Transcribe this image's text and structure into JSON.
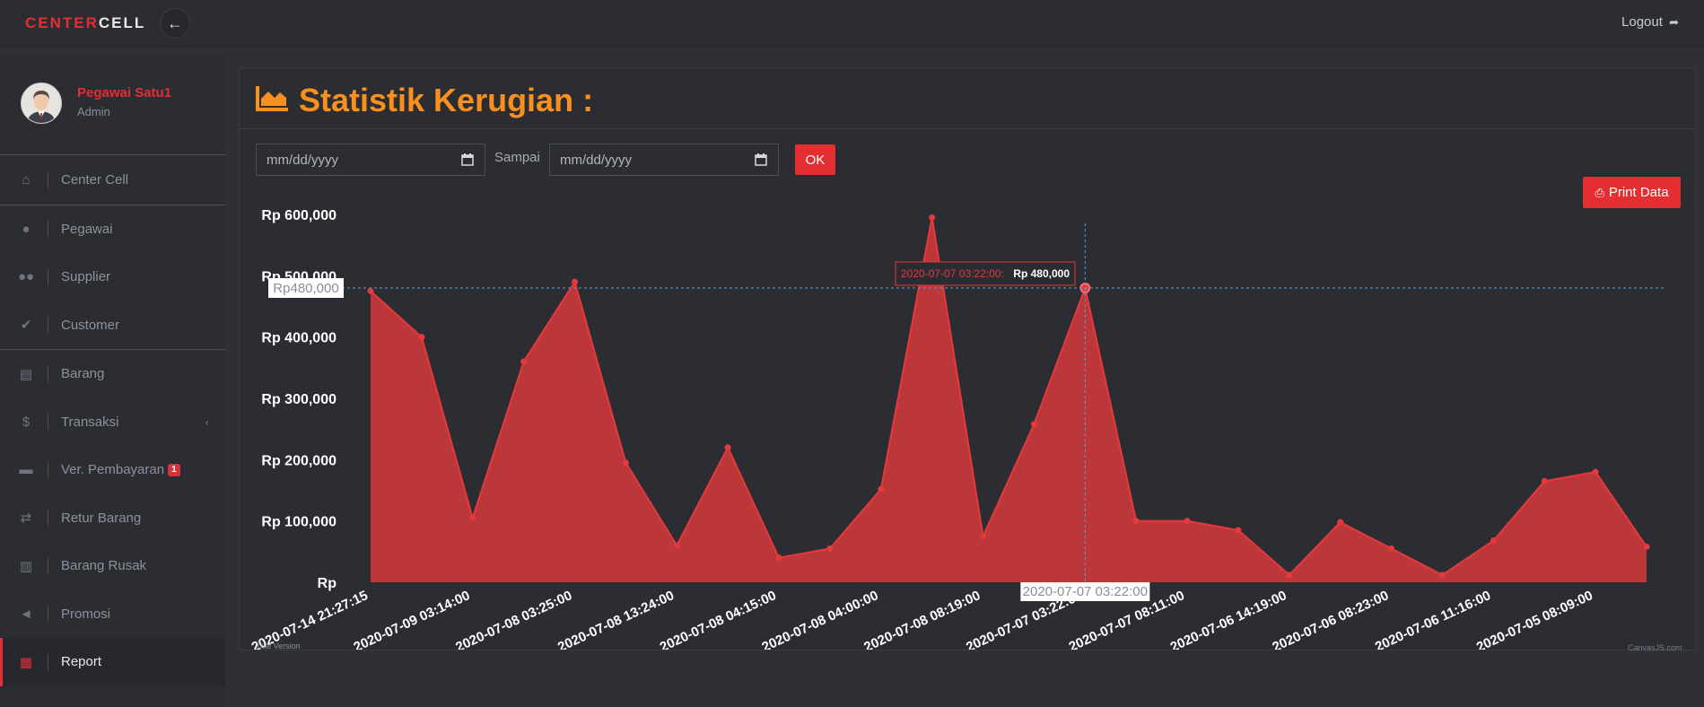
{
  "brand": {
    "part1": "CENTER",
    "part2": "CELL"
  },
  "topbar": {
    "back_icon": "arrow-left-icon",
    "logout_label": "Logout"
  },
  "profile": {
    "name": "Pegawai Satu1",
    "role": "Admin"
  },
  "sidebar": {
    "items": [
      {
        "label": "Center Cell",
        "icon": "store-icon"
      },
      {
        "label": "Pegawai",
        "icon": "user-icon"
      },
      {
        "label": "Supplier",
        "icon": "users-icon"
      },
      {
        "label": "Customer",
        "icon": "user-check-icon"
      },
      {
        "label": "Barang",
        "icon": "archive-icon"
      },
      {
        "label": "Transaksi",
        "icon": "money-icon"
      },
      {
        "label": "Ver. Pembayaran",
        "icon": "card-icon",
        "badge": "1"
      },
      {
        "label": "Retur Barang",
        "icon": "exchange-icon"
      },
      {
        "label": "Barang Rusak",
        "icon": "trash-icon"
      },
      {
        "label": "Promosi",
        "icon": "megaphone-icon"
      },
      {
        "label": "Report",
        "icon": "report-icon"
      }
    ]
  },
  "page": {
    "title": "Statistik Kerugian :",
    "date_from_placeholder": "mm/dd/yyyy",
    "sampai_label": "Sampai",
    "date_to_placeholder": "mm/dd/yyyy",
    "ok_label": "OK",
    "print_label": "Print Data"
  },
  "colors": {
    "accent": "#e52e32",
    "title": "#f7901e",
    "area_fill": "#c9383a"
  },
  "chart_data": {
    "type": "area",
    "x_tick_labels": [
      "2020-07-14 21:27:15",
      "2020-07-09 03:14:00",
      "2020-07-08 03:25:00",
      "2020-07-08 13:24:00",
      "2020-07-08 04:15:00",
      "2020-07-08 04:00:00",
      "2020-07-08 08:19:00",
      "2020-07-07 03:22:00",
      "2020-07-07 08:11:00",
      "2020-07-06 14:19:00",
      "2020-07-06 08:23:00",
      "2020-07-06 11:16:00",
      "2020-07-05 08:09:00"
    ],
    "values": [
      475000,
      400000,
      105000,
      360000,
      490000,
      195000,
      60000,
      220000,
      40000,
      55000,
      152000,
      595000,
      75000,
      258000,
      480000,
      100000,
      100000,
      85000,
      12000,
      98000,
      55000,
      12000,
      68000,
      165000,
      180000,
      58000
    ],
    "y_ticks": [
      "Rp",
      "Rp 100,000",
      "Rp 200,000",
      "Rp 300,000",
      "Rp 400,000",
      "Rp 500,000",
      "Rp 600,000"
    ],
    "ylim": [
      0,
      600000
    ],
    "tooltip": {
      "x": "2020-07-07 03:22:00",
      "value": "Rp 480,000",
      "index": 14
    },
    "crosshair_y_label": "Rp480,000",
    "crosshair_x_label": "2020-07-07 03:22:00",
    "watermark_left": "Trial Version",
    "watermark_right": "CanvasJS.com"
  }
}
